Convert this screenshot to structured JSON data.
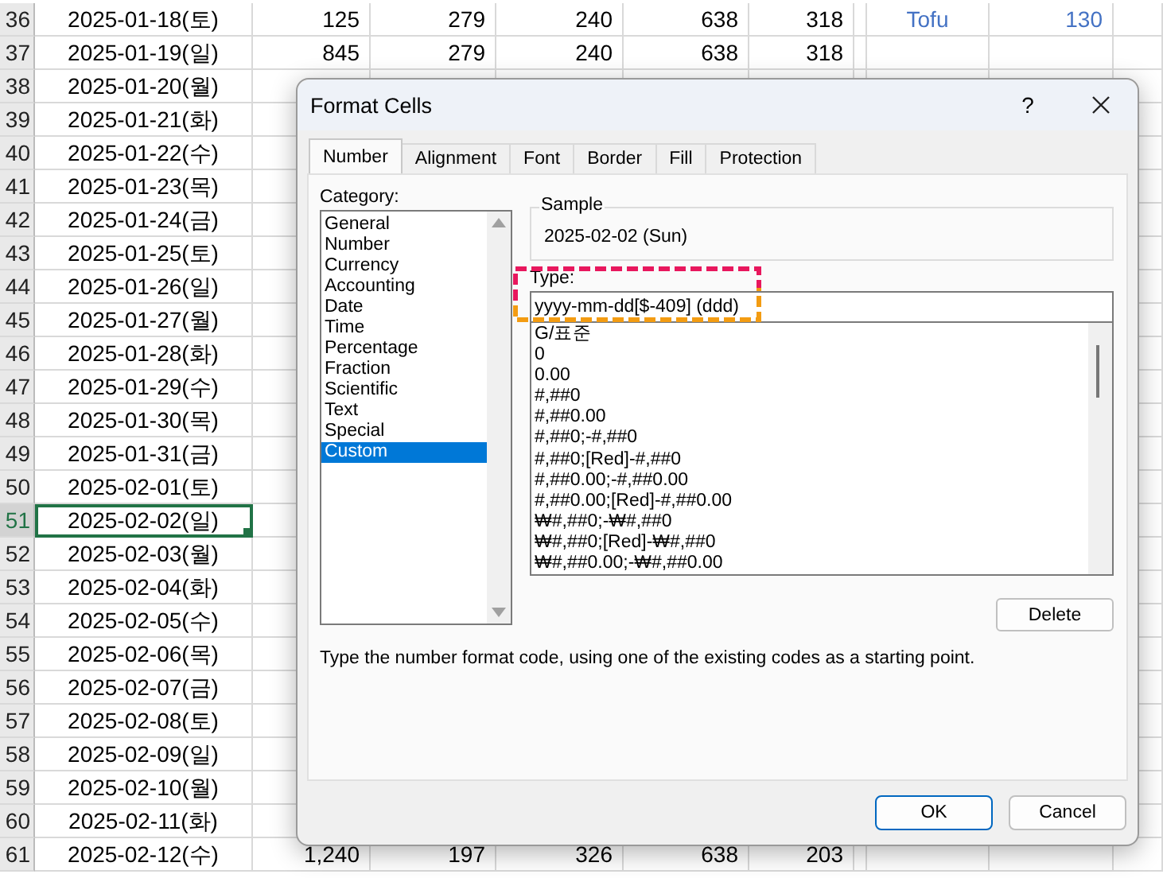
{
  "sheet": {
    "rows": [
      {
        "row": "36",
        "date": "2025-01-18(토)",
        "cells": [
          "125",
          "279",
          "240",
          "638",
          "318"
        ],
        "extra": [
          "Tofu",
          "130"
        ],
        "selected": false
      },
      {
        "row": "37",
        "date": "2025-01-19(일)",
        "cells": [
          "845",
          "279",
          "240",
          "638",
          "318"
        ],
        "extra": [],
        "selected": false
      },
      {
        "row": "38",
        "date": "2025-01-20(월)",
        "cells": [],
        "extra": [],
        "selected": false
      },
      {
        "row": "39",
        "date": "2025-01-21(화)",
        "cells": [],
        "extra": [],
        "selected": false
      },
      {
        "row": "40",
        "date": "2025-01-22(수)",
        "cells": [],
        "extra": [],
        "selected": false
      },
      {
        "row": "41",
        "date": "2025-01-23(목)",
        "cells": [],
        "extra": [],
        "selected": false
      },
      {
        "row": "42",
        "date": "2025-01-24(금)",
        "cells": [],
        "extra": [],
        "selected": false
      },
      {
        "row": "43",
        "date": "2025-01-25(토)",
        "cells": [],
        "extra": [],
        "selected": false
      },
      {
        "row": "44",
        "date": "2025-01-26(일)",
        "cells": [],
        "extra": [],
        "selected": false
      },
      {
        "row": "45",
        "date": "2025-01-27(월)",
        "cells": [],
        "extra": [],
        "selected": false
      },
      {
        "row": "46",
        "date": "2025-01-28(화)",
        "cells": [],
        "extra": [],
        "selected": false
      },
      {
        "row": "47",
        "date": "2025-01-29(수)",
        "cells": [],
        "extra": [],
        "selected": false
      },
      {
        "row": "48",
        "date": "2025-01-30(목)",
        "cells": [],
        "extra": [],
        "selected": false
      },
      {
        "row": "49",
        "date": "2025-01-31(금)",
        "cells": [],
        "extra": [],
        "selected": false
      },
      {
        "row": "50",
        "date": "2025-02-01(토)",
        "cells": [],
        "extra": [],
        "selected": false
      },
      {
        "row": "51",
        "date": "2025-02-02(일)",
        "cells": [],
        "extra": [],
        "selected": true
      },
      {
        "row": "52",
        "date": "2025-02-03(월)",
        "cells": [],
        "extra": [],
        "selected": false
      },
      {
        "row": "53",
        "date": "2025-02-04(화)",
        "cells": [],
        "extra": [],
        "selected": false
      },
      {
        "row": "54",
        "date": "2025-02-05(수)",
        "cells": [],
        "extra": [],
        "selected": false
      },
      {
        "row": "55",
        "date": "2025-02-06(목)",
        "cells": [],
        "extra": [],
        "selected": false
      },
      {
        "row": "56",
        "date": "2025-02-07(금)",
        "cells": [],
        "extra": [],
        "selected": false
      },
      {
        "row": "57",
        "date": "2025-02-08(토)",
        "cells": [],
        "extra": [],
        "selected": false
      },
      {
        "row": "58",
        "date": "2025-02-09(일)",
        "cells": [],
        "extra": [],
        "selected": false
      },
      {
        "row": "59",
        "date": "2025-02-10(월)",
        "cells": [],
        "extra": [],
        "selected": false
      },
      {
        "row": "60",
        "date": "2025-02-11(화)",
        "cells": [],
        "extra": [],
        "selected": false
      },
      {
        "row": "61",
        "date": "2025-02-12(수)",
        "cells": [
          "1,240",
          "197",
          "326",
          "638",
          "203"
        ],
        "extra": [],
        "selected": false
      }
    ]
  },
  "dialog": {
    "title": "Format Cells",
    "help": "?",
    "tabs": [
      {
        "label": "Number",
        "selected": true
      },
      {
        "label": "Alignment",
        "selected": false
      },
      {
        "label": "Font",
        "selected": false
      },
      {
        "label": "Border",
        "selected": false
      },
      {
        "label": "Fill",
        "selected": false
      },
      {
        "label": "Protection",
        "selected": false
      }
    ],
    "category_label": "Category:",
    "categories": [
      {
        "label": "General",
        "selected": false
      },
      {
        "label": "Number",
        "selected": false
      },
      {
        "label": "Currency",
        "selected": false
      },
      {
        "label": "Accounting",
        "selected": false
      },
      {
        "label": "Date",
        "selected": false
      },
      {
        "label": "Time",
        "selected": false
      },
      {
        "label": "Percentage",
        "selected": false
      },
      {
        "label": "Fraction",
        "selected": false
      },
      {
        "label": "Scientific",
        "selected": false
      },
      {
        "label": "Text",
        "selected": false
      },
      {
        "label": "Special",
        "selected": false
      },
      {
        "label": "Custom",
        "selected": true
      }
    ],
    "sample_label": "Sample",
    "sample_value": "2025-02-02 (Sun)",
    "type_label": "Type:",
    "type_value": "yyyy-mm-dd[$-409] (ddd)",
    "formats": [
      "G/표준",
      "0",
      "0.00",
      "#,##0",
      "#,##0.00",
      "#,##0;-#,##0",
      "#,##0;[Red]-#,##0",
      "#,##0.00;-#,##0.00",
      "#,##0.00;[Red]-#,##0.00",
      "₩#,##0;-₩#,##0",
      "₩#,##0;[Red]-₩#,##0",
      "₩#,##0.00;-₩#,##0.00"
    ],
    "delete_button": "Delete",
    "description": "Type the number format code, using one of the existing codes as a starting point.",
    "buttons": [
      "OK",
      "Cancel"
    ]
  }
}
